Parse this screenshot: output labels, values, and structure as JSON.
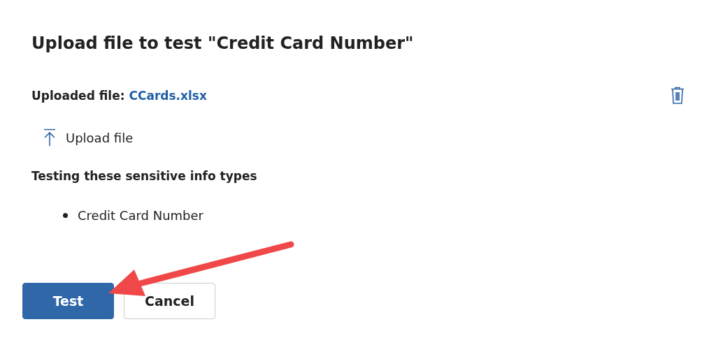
{
  "dialog": {
    "title": "Upload file to test \"Credit Card Number\""
  },
  "uploaded_file": {
    "label": "Uploaded file:",
    "file_name": "CCards.xlsx"
  },
  "upload_button": {
    "label": "Upload file"
  },
  "section": {
    "heading": "Testing these sensitive info types",
    "items": [
      "Credit Card Number"
    ]
  },
  "buttons": [
    {
      "label": "Test",
      "kind": "primary"
    },
    {
      "label": "Cancel",
      "kind": "secondary"
    }
  ]
}
